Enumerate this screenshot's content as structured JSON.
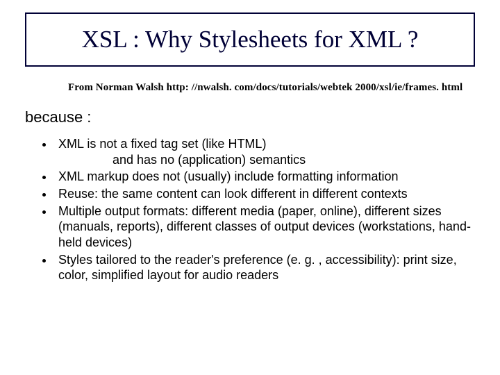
{
  "title": "XSL : Why Stylesheets for XML ?",
  "source_prefix": "From Norman Walsh ",
  "source_url": "http: //nwalsh. com/docs/tutorials/webtek 2000/xsl/ie/frames. html",
  "because_label": "because :",
  "bullets": {
    "b0_line1": "XML  is not a fixed tag set (like HTML)",
    "b0_line2": "and has no (application) semantics",
    "b1": "XML markup does not (usually) include formatting information",
    "b2": "Reuse: the same content can look different in different contexts",
    "b3": "Multiple output formats: different media (paper, online), different sizes (manuals, reports), different classes of output devices (workstations, hand-held devices)",
    "b4": "Styles tailored to the reader's preference (e. g. , accessibility): print size, color, simplified layout for audio readers"
  }
}
